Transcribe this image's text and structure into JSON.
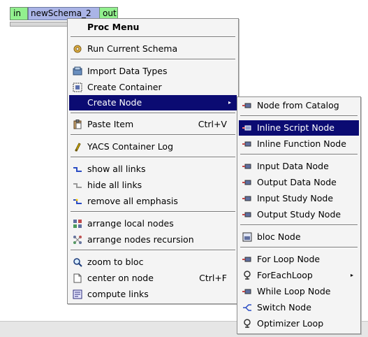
{
  "node": {
    "in_port": "in",
    "title": "newSchema_2",
    "out_port": "out"
  },
  "proc_menu": {
    "title": "Proc Menu",
    "run": "Run Current Schema",
    "import_types": "Import Data Types",
    "create_container": "Create Container",
    "create_node": "Create Node",
    "paste_item": "Paste Item",
    "paste_shortcut": "Ctrl+V",
    "yacs_log": "YACS Container Log",
    "show_links": "show all links",
    "hide_links": "hide all links",
    "remove_emphasis": "remove all emphasis",
    "arrange_local": "arrange local nodes",
    "arrange_recursion": "arrange nodes recursion",
    "zoom_bloc": "zoom to bloc",
    "center_node": "center on node",
    "center_shortcut": "Ctrl+F",
    "compute_links": "compute links"
  },
  "sub_menu": {
    "from_catalog": "Node from Catalog",
    "inline_script": "Inline Script Node",
    "inline_function": "Inline Function Node",
    "input_data": "Input Data Node",
    "output_data": "Output Data Node",
    "input_study": "Input Study Node",
    "output_study": "Output Study Node",
    "bloc": "bloc Node",
    "for_loop": "For Loop Node",
    "foreach_loop": "ForEachLoop",
    "while_loop": "While Loop Node",
    "switch": "Switch Node",
    "optimizer": "Optimizer Loop"
  },
  "colors": {
    "highlight": "#0b0b72",
    "port_green": "#92f08e",
    "node_blue": "#aab4e6"
  }
}
